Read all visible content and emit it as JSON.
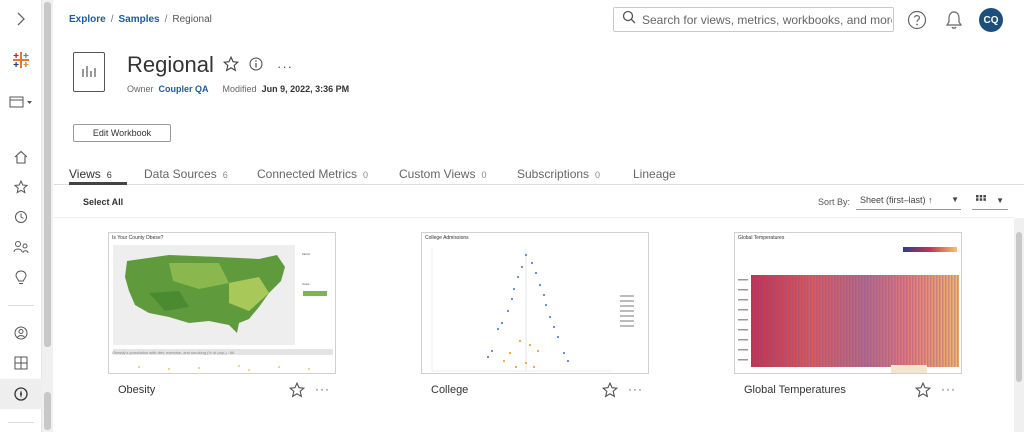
{
  "breadcrumb": {
    "explore": "Explore",
    "samples": "Samples",
    "current": "Regional"
  },
  "search": {
    "placeholder": "Search for views, metrics, workbooks, and more"
  },
  "user": {
    "initials": "CQ"
  },
  "workbook": {
    "title": "Regional",
    "owner_label": "Owner",
    "owner": "Coupler QA",
    "modified_label": "Modified",
    "modified": "Jun 9, 2022, 3:36 PM",
    "edit_label": "Edit Workbook"
  },
  "tabs": [
    {
      "label": "Views",
      "count": "6"
    },
    {
      "label": "Data Sources",
      "count": "6"
    },
    {
      "label": "Connected Metrics",
      "count": "0"
    },
    {
      "label": "Custom Views",
      "count": "0"
    },
    {
      "label": "Subscriptions",
      "count": "0"
    },
    {
      "label": "Lineage",
      "count": ""
    }
  ],
  "toolbar": {
    "select_all": "Select All",
    "sort_label": "Sort By:",
    "sort_value": "Sheet (first–last) ↑"
  },
  "views": [
    {
      "name": "Obesity",
      "thumb_title": "Is Your County Obese?",
      "thumb_caption": "Obesity's correlation with diet, exercise, and smoking (% of pop.) : 66"
    },
    {
      "name": "College",
      "thumb_title": "College Admissions"
    },
    {
      "name": "Global Temperatures",
      "thumb_title": "Global Temperatures"
    }
  ],
  "colors": {
    "accent": "#1f5b99",
    "avatar": "#1d4f7c"
  }
}
